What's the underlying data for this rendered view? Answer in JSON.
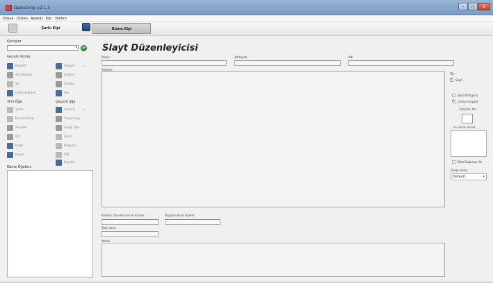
{
  "window": {
    "title": "OpenSong v2.1.3",
    "min_glyph": "–",
    "max_glyph": "□",
    "close_glyph": "x"
  },
  "menu": [
    "Dosya",
    "Düzen",
    "Ayarlar",
    "Kip",
    "Yardım"
  ],
  "toolbar": {
    "song_mode": "Şarkı Kipi",
    "set_mode": "Küme Kipi"
  },
  "left": {
    "sets_label": "Kümeler",
    "refresh_glyph": "⟳",
    "current_set_label": "Geçerli Küme",
    "set_actions": [
      {
        "label": "Kaydet"
      },
      {
        "label": "Sunum",
        "sub": "▸"
      },
      {
        "label": "Ad Değiştir"
      },
      {
        "label": "Şablon"
      },
      {
        "label": "Sil"
      },
      {
        "label": "Ortala"
      },
      {
        "label": "Farklı Kaydet"
      },
      {
        "label": "Ver"
      }
    ],
    "new_item_label": "Yeni Öğe",
    "current_item_label": "Geçerli öğe",
    "item_actions": [
      {
        "label": "Şarkı"
      },
      {
        "label": "Sunum",
        "sub": "▸"
      },
      {
        "label": "Kutsal Kitap"
      },
      {
        "label": "Yukarı taşı"
      },
      {
        "label": "Slaytlar"
      },
      {
        "label": "Aşağı Taşı"
      },
      {
        "label": "Stil"
      },
      {
        "label": "Çıkar"
      },
      {
        "label": "Imge"
      },
      {
        "label": "Kopyala"
      },
      {
        "label": "Dışsal"
      },
      {
        "label": "Stil"
      },
      {
        "label": ""
      },
      {
        "label": "Kaydet"
      }
    ],
    "set_items_label": "Küme Öğeleri:"
  },
  "main": {
    "title": "Slayt Düzenleyicisi",
    "title_field_label": "Başlık:",
    "subtitle_field_label": "Alt başlık:",
    "name_field_label": "Adı:",
    "slides_label": "Slaytlar:",
    "use_custom_order_label": "Kullanıcı tanımlı sunum düzeni:",
    "custom_order_label": "Özgün sunum düzeni:",
    "song_key_label": "Şarkı tonu:",
    "notes_label": "Notlar"
  },
  "right": {
    "type_label": "Tür:",
    "slide_label": "Slayt",
    "loop_label": "Slayt Döngüsü",
    "print_label": "Listeye Kaydet",
    "slide_every_label": "Slaytları her",
    "seconds_label": "sn. de bir ilerlet",
    "bg_label": "Bilet Doğuruşı Ab",
    "theme_label": "Gezgi kullan",
    "theme_value": "Default"
  }
}
